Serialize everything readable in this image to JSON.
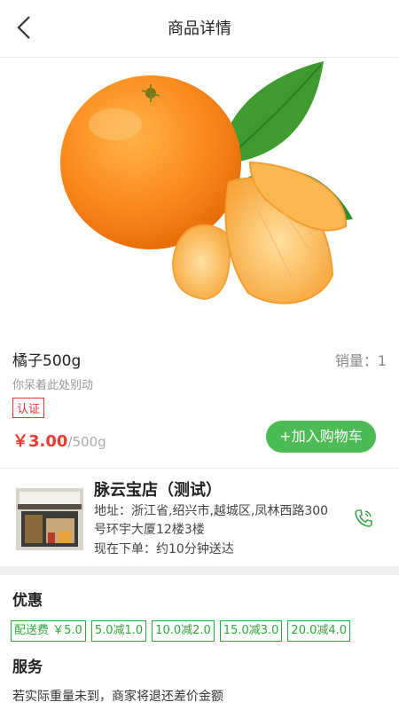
{
  "header": {
    "title": "商品详情"
  },
  "product": {
    "name": "橘子500g",
    "sales_label": "销量：1",
    "slogan": "你呆着此处别动",
    "cert_badge": "认证",
    "price": "￥3.00",
    "unit": "/500g",
    "add_to_cart": "+加入购物车"
  },
  "store": {
    "name": "脉云宝店（测试）",
    "address": "地址：浙江省,绍兴市,越城区,凤林西路300号环宇大厦12楼3楼",
    "delivery": "现在下单：约10分钟送达"
  },
  "discounts": {
    "title": "优惠",
    "items": [
      "配送费 ￥5.0",
      "5.0减1.0",
      "10.0减2.0",
      "15.0减3.0",
      "20.0减4.0"
    ]
  },
  "service": {
    "title": "服务",
    "text": "若实际重量未到，商家将退还差价金额"
  },
  "colors": {
    "price": "#e83a2e",
    "accent_green": "#4cbb55",
    "coupon_green": "#2ea83b",
    "cert_red": "#ee3333"
  },
  "icons": [
    "chevron-left-icon",
    "phone-icon"
  ]
}
